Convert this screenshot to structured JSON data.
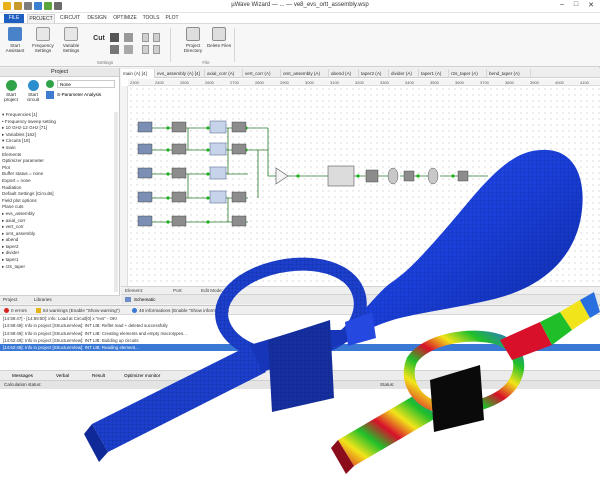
{
  "window": {
    "title": "µWave Wizard — ... — ve8_evs_ortt_assembly.wsp"
  },
  "menu": {
    "tabs": [
      "FILE",
      "PROJECT",
      "CIRCUIT",
      "DESIGN",
      "OPTIMIZE",
      "TOOLS",
      "PLOT"
    ],
    "active": "PROJECT"
  },
  "ribbon": {
    "start_assistant": "Start Assistant",
    "frequency_settings": "Frequency Settings",
    "variable_settings": "Variable Settings",
    "cut": "Cut",
    "group_settings": "Settings",
    "project_directory": "Project Directory",
    "delete_files": "Delete Files",
    "group_file": "File"
  },
  "project_panel": {
    "title": "Project",
    "start_project": "Start project",
    "start_circuit": "Start circuit",
    "run_mode": "None",
    "analysis": "S-Parameter Analysis",
    "tree": [
      "▾ Frequencies [1]",
      "   • Frequency sweep setting",
      "   ▸ 10 GHz-12 GHz [71]",
      "▸ Variables [162]",
      "▾ Circuits [18]",
      "  ▾ main",
      "      Elements",
      "      Optimizer parameter",
      "      Plot",
      "      Buffer status = none",
      "      Export = none",
      "      Radiation",
      "      Default Settings [Circuits]",
      "      Field plot options",
      "      Plane cuts",
      "  ▸ evs_assembly",
      "  ▸ axial_corr",
      "  ▸ vert_corr",
      "  ▸ omt_assembly",
      "  ▸ abend",
      "  ▸ taper2",
      "  ▸ divider",
      "  ▸ taper1",
      "  ▸ r2s_taper"
    ],
    "bottom_tabs": [
      "Project",
      "Libraries"
    ]
  },
  "editor": {
    "doc_tabs": [
      "main (A) [4]",
      "evs_assembly (A) [4]",
      "axial_corr (A)",
      "vert_corr (A)",
      "omt_assembly (A)",
      "abend (A)",
      "taper2 (A)",
      "divider (A)",
      "taper1 (A)",
      "r2s_taper (A)",
      "bend_taper (A)"
    ],
    "ruler_ticks": [
      "2300",
      "2400",
      "2500",
      "2600",
      "2700",
      "2800",
      "2900",
      "3000",
      "3100",
      "3200",
      "3300",
      "3400",
      "3500",
      "3600",
      "3700",
      "3800",
      "3900",
      "4000",
      "4100"
    ],
    "status_items": [
      "Element:",
      "Port:",
      "Edit Mode:"
    ],
    "bottom_tab": "Schematic"
  },
  "messages": {
    "summary": [
      "0 errors",
      "54 warnings (Enable \"Show warning\")",
      "48 informations (Enable \"Show information\")"
    ],
    "rows": [
      "[14:59:47] - [14:59:50]: info: Load at Circuit[0] x \"evs\" - OK!",
      "[14:59:49]: Info in project [StructureView]: INT LIB: Reflet read + deleted successfully",
      "[14:59:49]: Info in project [StructureView]: INT LIB: Creating elements and empty macrotypes...",
      "[14:62:49]: Info in project [StructureView]: INT LIB: Building up circuits",
      "[14:62:49]: Info in project [StructureView]: INT LIB: Reading element..."
    ],
    "tabs": [
      "Messages",
      "Verbal",
      "Result",
      "Optimizer monitor"
    ],
    "status_left": "Calculation status:",
    "status_right": "Status:"
  },
  "colors": {
    "accent": "#1f5fbf",
    "selection": "#3a78d6",
    "model_blue": "#1a3fd8",
    "field_red": "#d8102a",
    "field_yellow": "#f2e41a",
    "field_green": "#1fbf2a"
  }
}
